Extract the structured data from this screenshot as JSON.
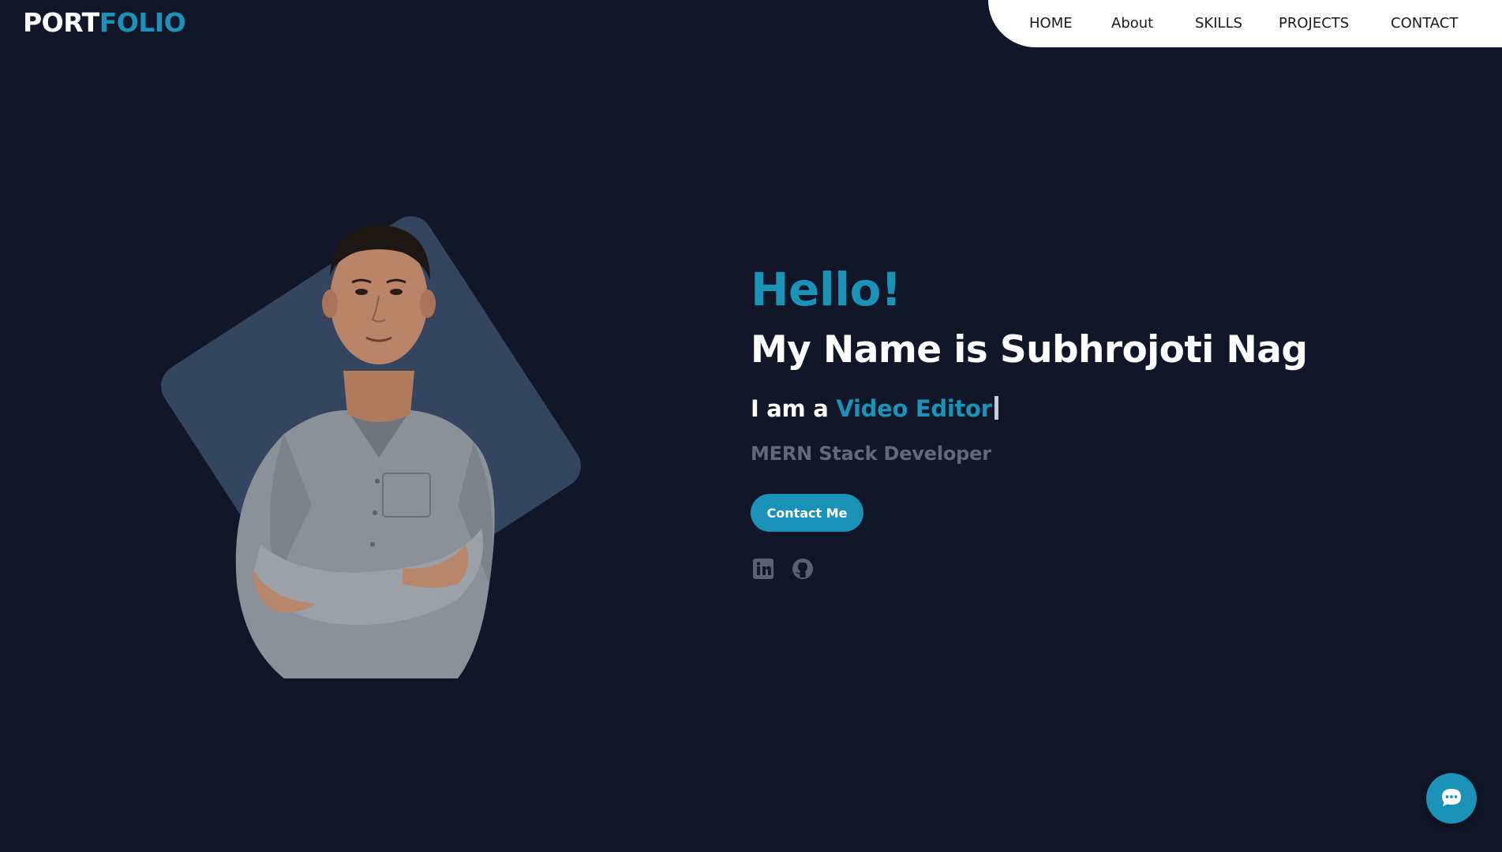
{
  "header": {
    "logo_part1": "PORT",
    "logo_part2": "FOLIO",
    "nav": {
      "home": "HOME",
      "about": "About",
      "skills": "SKILLS",
      "projects": "PROJECTS",
      "contact": "CONTACT"
    }
  },
  "hero": {
    "greeting": "Hello!",
    "name_line": "My Name is Subhrojoti Nag",
    "role_prefix": "I am a ",
    "role_highlight": "Video Editor",
    "subtitle": "MERN Stack Developer",
    "contact_button": "Contact Me",
    "photo_alt": "Portrait of Subhrojoti Nag"
  },
  "social": {
    "linkedin_icon": "linkedin-icon",
    "github_icon": "github-icon"
  },
  "chat": {
    "icon": "chat-bubble-icon"
  },
  "colors": {
    "background": "#111729",
    "accent": "#1b92b8",
    "card": "#33455f",
    "muted_text": "#626978",
    "nav_background": "#ffffff"
  }
}
